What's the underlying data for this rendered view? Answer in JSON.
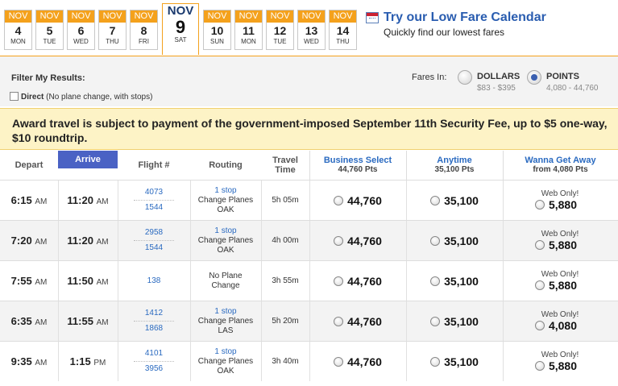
{
  "dates": [
    {
      "month": "NOV",
      "day": "4",
      "dow": "MON"
    },
    {
      "month": "NOV",
      "day": "5",
      "dow": "TUE"
    },
    {
      "month": "NOV",
      "day": "6",
      "dow": "WED"
    },
    {
      "month": "NOV",
      "day": "7",
      "dow": "THU"
    },
    {
      "month": "NOV",
      "day": "8",
      "dow": "FRI"
    },
    {
      "month": "NOV",
      "day": "9",
      "dow": "SAT",
      "selected": true
    },
    {
      "month": "NOV",
      "day": "10",
      "dow": "SUN"
    },
    {
      "month": "NOV",
      "day": "11",
      "dow": "MON"
    },
    {
      "month": "NOV",
      "day": "12",
      "dow": "TUE"
    },
    {
      "month": "NOV",
      "day": "13",
      "dow": "WED"
    },
    {
      "month": "NOV",
      "day": "14",
      "dow": "THU"
    }
  ],
  "promo": {
    "title": "Try our Low Fare Calendar",
    "subtitle": "Quickly find our lowest fares"
  },
  "filter": {
    "title": "Filter My Results:",
    "direct_label": "Direct",
    "direct_note": "(No plane change, with stops)",
    "fares_in_label": "Fares In:",
    "dollars_label": "DOLLARS",
    "dollars_range": "$83 - $395",
    "points_label": "POINTS",
    "points_range": "4,080 - 44,760"
  },
  "notice": "Award travel is subject to payment of the government-imposed September 11th Security Fee, up to $5 one-way, $10 roundtrip.",
  "headers": {
    "depart": "Depart",
    "arrive": "Arrive",
    "flight": "Flight #",
    "routing": "Routing",
    "travel_1": "Travel",
    "travel_2": "Time",
    "business": "Business Select",
    "business_sub": "44,760 Pts",
    "anytime": "Anytime",
    "anytime_sub": "35,100 Pts",
    "wanna": "Wanna Get Away",
    "wanna_sub": "from 4,080 Pts"
  },
  "rows": [
    {
      "depart": "6:15",
      "depart_ampm": "AM",
      "arrive": "11:20",
      "arrive_ampm": "AM",
      "flights": [
        "4073",
        "1544"
      ],
      "stop": "1 stop",
      "route_1": "Change Planes",
      "route_2": "OAK",
      "travel": "5h 05m",
      "business": "44,760",
      "anytime": "35,100",
      "web_only": "Web Only!",
      "wanna": "5,880"
    },
    {
      "depart": "7:20",
      "depart_ampm": "AM",
      "arrive": "11:20",
      "arrive_ampm": "AM",
      "flights": [
        "2958",
        "1544"
      ],
      "stop": "1 stop",
      "route_1": "Change Planes",
      "route_2": "OAK",
      "travel": "4h 00m",
      "business": "44,760",
      "anytime": "35,100",
      "web_only": "Web Only!",
      "wanna": "5,880"
    },
    {
      "depart": "7:55",
      "depart_ampm": "AM",
      "arrive": "11:50",
      "arrive_ampm": "AM",
      "flights": [
        "138"
      ],
      "stop": "",
      "route_1": "No Plane",
      "route_2": "Change",
      "travel": "3h 55m",
      "business": "44,760",
      "anytime": "35,100",
      "web_only": "Web Only!",
      "wanna": "5,880"
    },
    {
      "depart": "6:35",
      "depart_ampm": "AM",
      "arrive": "11:55",
      "arrive_ampm": "AM",
      "flights": [
        "1412",
        "1868"
      ],
      "stop": "1 stop",
      "route_1": "Change Planes",
      "route_2": "LAS",
      "travel": "5h 20m",
      "business": "44,760",
      "anytime": "35,100",
      "web_only": "Web Only!",
      "wanna": "4,080"
    },
    {
      "depart": "9:35",
      "depart_ampm": "AM",
      "arrive": "1:15",
      "arrive_ampm": "PM",
      "flights": [
        "4101",
        "3956"
      ],
      "stop": "1 stop",
      "route_1": "Change Planes",
      "route_2": "OAK",
      "travel": "3h 40m",
      "business": "44,760",
      "anytime": "35,100",
      "web_only": "Web Only!",
      "wanna": "5,880"
    }
  ]
}
